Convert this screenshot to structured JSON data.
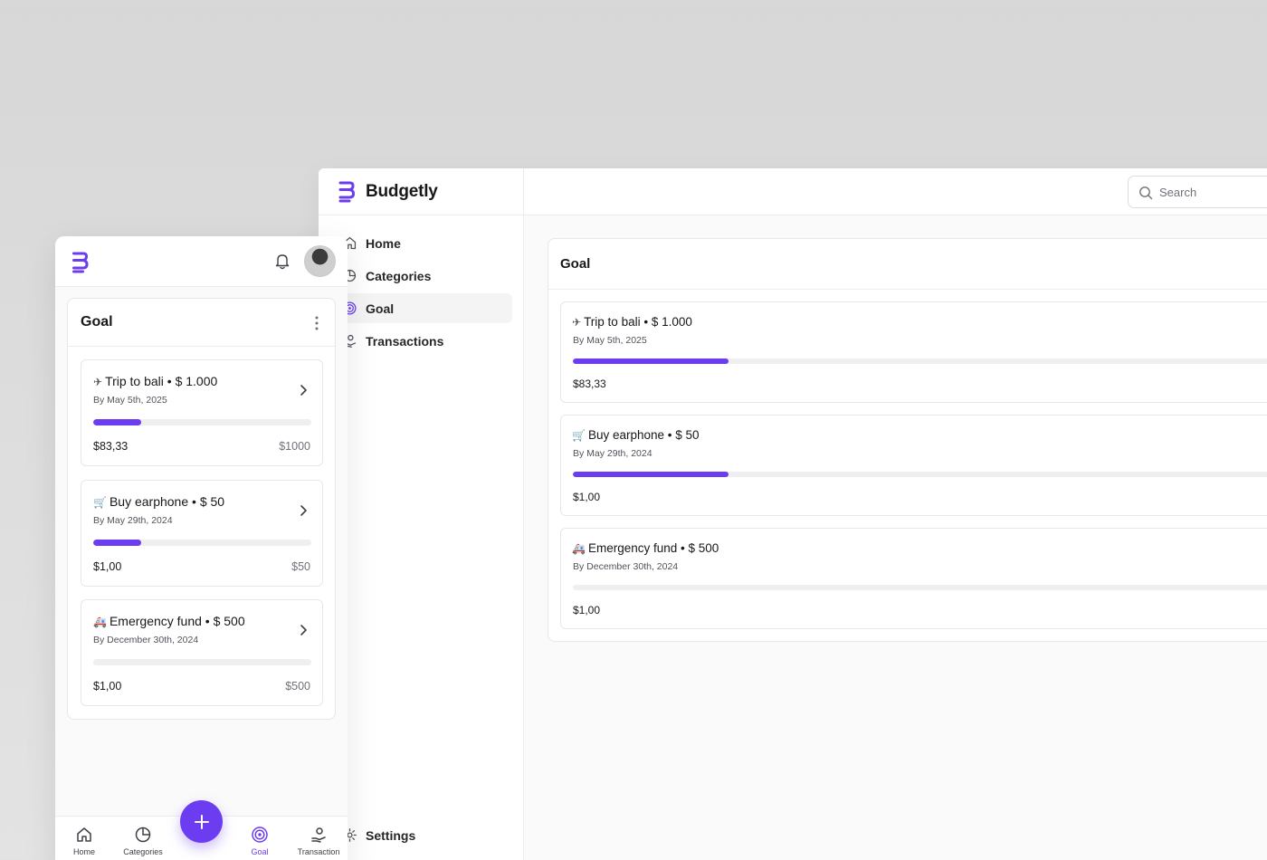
{
  "desktop": {
    "brand": "Budgetly",
    "search": {
      "placeholder": "Search"
    },
    "nav": [
      {
        "label": "Home",
        "icon": "home-icon"
      },
      {
        "label": "Categories",
        "icon": "pie-chart-icon"
      },
      {
        "label": "Goal",
        "icon": "target-icon",
        "active": true
      },
      {
        "label": "Transactions",
        "icon": "hand-coins-icon"
      }
    ],
    "settings_label": "Settings",
    "card_title": "Goal",
    "goals": [
      {
        "emoji": "✈",
        "title": "Trip to bali • $ 1.000",
        "date": "By May 5th, 2025",
        "amount": "$83,33",
        "progress": 0.2
      },
      {
        "emoji": "🛒",
        "title": "Buy earphone • $ 50",
        "date": "By May 29th, 2024",
        "amount": "$1,00",
        "progress": 0.2
      },
      {
        "emoji": "🚑",
        "title": "Emergency fund • $ 500",
        "date": "By December 30th, 2024",
        "amount": "$1,00",
        "progress": 0
      }
    ]
  },
  "mobile": {
    "card_title": "Goal",
    "goals": [
      {
        "emoji": "✈",
        "title": "Trip to bali • $ 1.000",
        "date": "By May 5th, 2025",
        "amount": "$83,33",
        "target": "$1000",
        "progress": 0.22
      },
      {
        "emoji": "🛒",
        "title": "Buy earphone • $ 50",
        "date": "By May 29th, 2024",
        "amount": "$1,00",
        "target": "$50",
        "progress": 0.22
      },
      {
        "emoji": "🚑",
        "title": "Emergency fund • $ 500",
        "date": "By December 30th, 2024",
        "amount": "$1,00",
        "target": "$500",
        "progress": 0
      }
    ],
    "tabs": [
      {
        "label": "Home",
        "icon": "home-icon"
      },
      {
        "label": "Categories",
        "icon": "pie-chart-icon"
      },
      {
        "label": "Goal",
        "icon": "target-icon",
        "active": true
      },
      {
        "label": "Transaction",
        "icon": "hand-coins-icon"
      }
    ]
  },
  "colors": {
    "accent": "#6c3df0",
    "track": "#efeff1",
    "border": "#e7e7ea"
  }
}
